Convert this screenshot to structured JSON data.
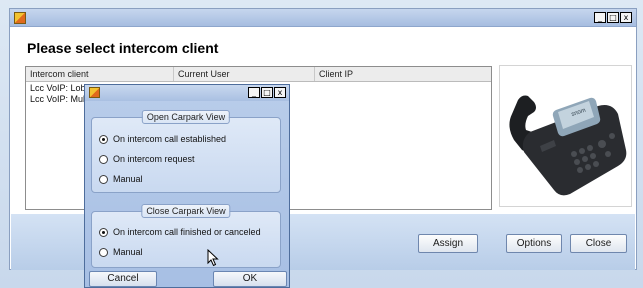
{
  "main_window": {
    "title": "",
    "heading": "Please select intercom client",
    "controls": {
      "minimize": "_",
      "maximize": "□",
      "close": "x"
    }
  },
  "client_list": {
    "columns": [
      "Intercom client",
      "Current User",
      "Client IP"
    ],
    "rows": [
      {
        "client": "Lcc VoIP: Lob",
        "user": "",
        "ip": ""
      },
      {
        "client": "Lcc VoIP: Mul",
        "user": "",
        "ip": ""
      }
    ]
  },
  "buttons": {
    "assign": "Assign",
    "options": "Options",
    "close": "Close"
  },
  "phone_image": {
    "icon": "desk-phone-icon",
    "brand_text": "snom"
  },
  "dialog": {
    "title": "",
    "controls": {
      "minimize": "_",
      "maximize": "□",
      "close": "x"
    },
    "open_group": {
      "legend": "Open Carpark View",
      "options": [
        {
          "label": "On intercom call established",
          "checked": true
        },
        {
          "label": "On intercom request",
          "checked": false
        },
        {
          "label": "Manual",
          "checked": false
        }
      ]
    },
    "close_group": {
      "legend": "Close Carpark View",
      "options": [
        {
          "label": "On intercom call finished or canceled",
          "checked": true
        },
        {
          "label": "Manual",
          "checked": false
        }
      ]
    },
    "cancel": "Cancel",
    "ok": "OK"
  },
  "colors": {
    "window_border": "#8a9fc0",
    "dialog_bg": "#b9cdea",
    "band_bg": "#c6d7ee"
  }
}
